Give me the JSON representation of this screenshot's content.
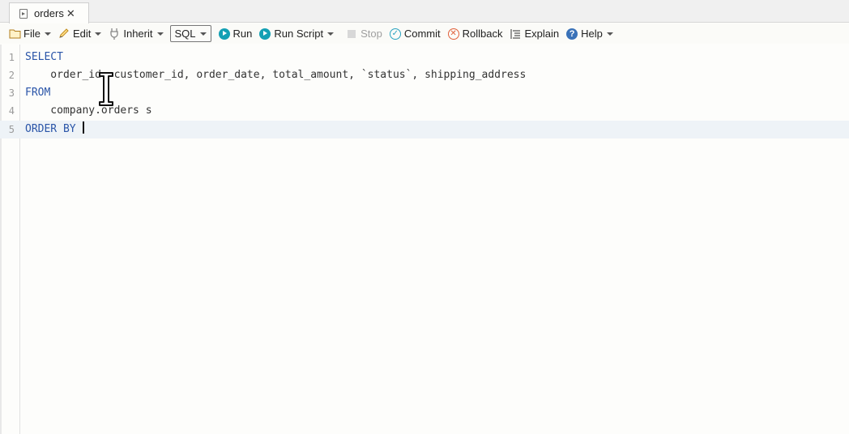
{
  "tab": {
    "title": "orders",
    "close_glyph": "✕",
    "icon": "script-file-icon"
  },
  "toolbar": {
    "file": "File",
    "edit": "Edit",
    "inherit": "Inherit",
    "sql": "SQL",
    "run": "Run",
    "run_script": "Run Script",
    "stop": "Stop",
    "commit": "Commit",
    "rollback": "Rollback",
    "explain": "Explain",
    "help": "Help"
  },
  "editor": {
    "lines": [
      {
        "num": "1",
        "kw": "SELECT",
        "text": ""
      },
      {
        "num": "2",
        "kw": "",
        "text": "    order_id, customer_id, order_date, total_amount, `status`, shipping_address"
      },
      {
        "num": "3",
        "kw": "FROM",
        "text": ""
      },
      {
        "num": "4",
        "kw": "",
        "text": "    company.orders s"
      },
      {
        "num": "5",
        "kw": "ORDER BY",
        "text": " "
      }
    ],
    "active_line": 5
  },
  "colors": {
    "keyword": "#2a55a8",
    "run": "#14a0b4",
    "active_line": "#eef3f7"
  }
}
